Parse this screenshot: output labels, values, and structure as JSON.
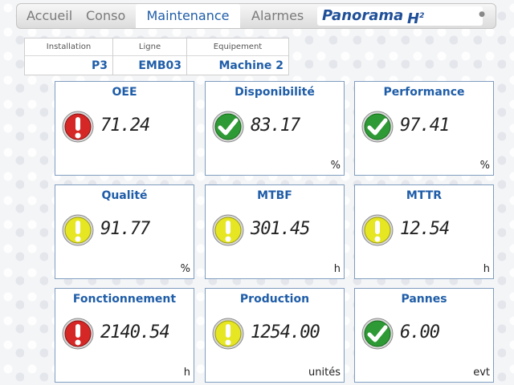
{
  "nav": {
    "tabs": [
      {
        "label": "Accueil"
      },
      {
        "label": "Conso"
      },
      {
        "label": "Maintenance"
      },
      {
        "label": "Alarmes"
      }
    ],
    "brand": {
      "name": "Panorama",
      "suffix": "H",
      "suffix_exp": "2"
    }
  },
  "info": {
    "columns": [
      {
        "header": "Installation",
        "value": "P3"
      },
      {
        "header": "Ligne",
        "value": "EMB03"
      },
      {
        "header": "Equipement",
        "value": "Machine 2"
      }
    ]
  },
  "colors": {
    "red": "#d62727",
    "green": "#2e9a35",
    "yellow": "#e6e623",
    "accent": "#1f5da8"
  },
  "kpis": [
    {
      "title": "OEE",
      "value": "71.24",
      "unit": "",
      "status": "red",
      "icon": "alert-icon"
    },
    {
      "title": "Disponibilité",
      "value": "83.17",
      "unit": "%",
      "status": "green",
      "icon": "check-icon"
    },
    {
      "title": "Performance",
      "value": "97.41",
      "unit": "%",
      "status": "green",
      "icon": "check-icon"
    },
    {
      "title": "Qualité",
      "value": "91.77",
      "unit": "%",
      "status": "yellow",
      "icon": "alert-icon"
    },
    {
      "title": "MTBF",
      "value": "301.45",
      "unit": "h",
      "status": "yellow",
      "icon": "alert-icon"
    },
    {
      "title": "MTTR",
      "value": "12.54",
      "unit": "h",
      "status": "yellow",
      "icon": "alert-icon"
    },
    {
      "title": "Fonctionnement",
      "value": "2140.54",
      "unit": "h",
      "status": "red",
      "icon": "alert-icon"
    },
    {
      "title": "Production",
      "value": "1254.00",
      "unit": "unités",
      "status": "yellow",
      "icon": "alert-icon"
    },
    {
      "title": "Pannes",
      "value": "6.00",
      "unit": "evt",
      "status": "green",
      "icon": "check-icon"
    }
  ]
}
